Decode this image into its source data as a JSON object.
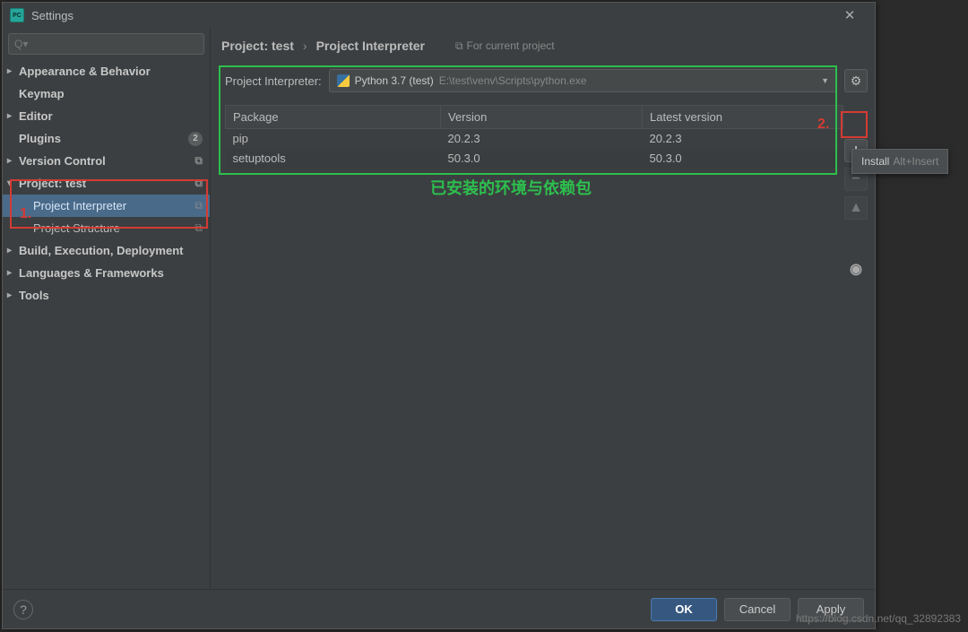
{
  "window": {
    "title": "Settings"
  },
  "search": {
    "placeholder": "Q▾"
  },
  "sidebar": {
    "items": [
      {
        "label": "Appearance & Behavior",
        "type": "collapsed",
        "bold": true
      },
      {
        "label": "Keymap",
        "type": "plain",
        "bold": true
      },
      {
        "label": "Editor",
        "type": "collapsed",
        "bold": true
      },
      {
        "label": "Plugins",
        "type": "plain",
        "bold": true,
        "badge": "2"
      },
      {
        "label": "Version Control",
        "type": "collapsed",
        "bold": true,
        "suffix_icon": true
      },
      {
        "label": "Project: test",
        "type": "expanded",
        "bold": true,
        "suffix_icon": true
      },
      {
        "label": "Project Interpreter",
        "type": "child",
        "selected": true,
        "suffix_icon": true
      },
      {
        "label": "Project Structure",
        "type": "child",
        "suffix_icon": true
      },
      {
        "label": "Build, Execution, Deployment",
        "type": "collapsed",
        "bold": true
      },
      {
        "label": "Languages & Frameworks",
        "type": "collapsed",
        "bold": true
      },
      {
        "label": "Tools",
        "type": "collapsed",
        "bold": true
      }
    ]
  },
  "breadcrumb": {
    "project": "Project: test",
    "page": "Project Interpreter",
    "hint": "For current project"
  },
  "interpreter": {
    "label": "Project Interpreter:",
    "name": "Python 3.7 (test)",
    "path": "E:\\test\\venv\\Scripts\\python.exe"
  },
  "table": {
    "cols": [
      "Package",
      "Version",
      "Latest version"
    ],
    "rows": [
      {
        "package": "pip",
        "version": "20.2.3",
        "latest": "20.2.3"
      },
      {
        "package": "setuptools",
        "version": "50.3.0",
        "latest": "50.3.0"
      }
    ]
  },
  "tooltip": {
    "label": "Install",
    "shortcut": "Alt+Insert"
  },
  "footer": {
    "ok": "OK",
    "cancel": "Cancel",
    "apply": "Apply"
  },
  "annotations": {
    "marker1": "1.",
    "marker2": "2.",
    "caption": "已安装的环境与依赖包"
  },
  "watermark": "https://blog.csdn.net/qq_32892383"
}
